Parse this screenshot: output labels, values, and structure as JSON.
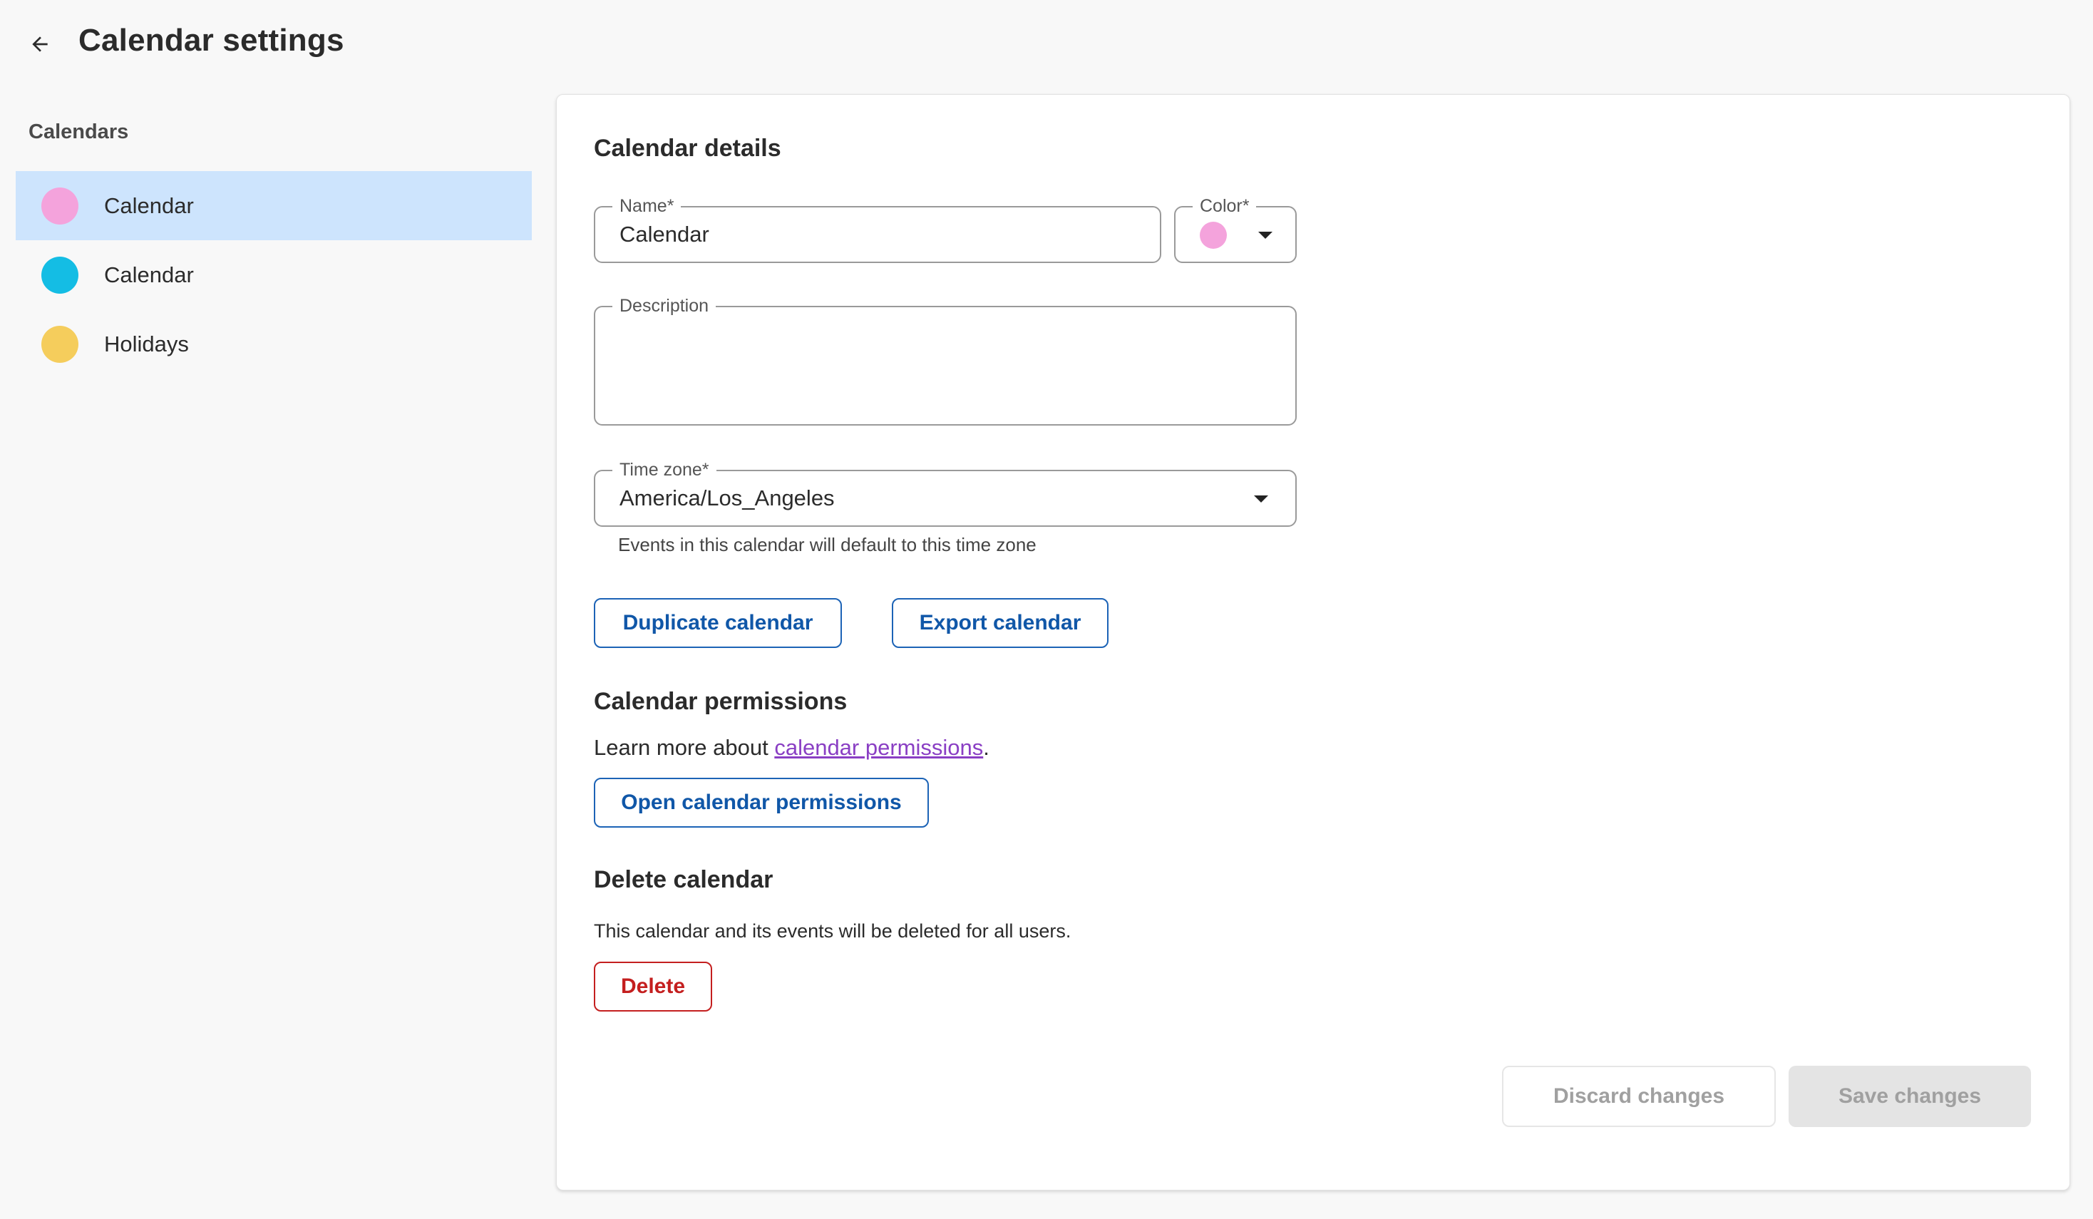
{
  "header": {
    "back_icon": "arrow-left-icon",
    "title": "Calendar settings"
  },
  "sidebar": {
    "heading": "Calendars",
    "items": [
      {
        "label": "Calendar",
        "color": "#f4a3dc",
        "selected": true
      },
      {
        "label": "Calendar",
        "color": "#14bde4",
        "selected": false
      },
      {
        "label": "Holidays",
        "color": "#f5cd5c",
        "selected": false
      }
    ]
  },
  "details": {
    "title": "Calendar details",
    "name": {
      "label": "Name",
      "required_mark": "*",
      "value": "Calendar"
    },
    "color": {
      "label": "Color",
      "required_mark": "*",
      "value": "#f4a3dc"
    },
    "description": {
      "label": "Description",
      "value": ""
    },
    "timezone": {
      "label": "Time zone",
      "required_mark": "*",
      "value": "America/Los_Angeles",
      "hint": "Events in this calendar will default to this time zone"
    },
    "duplicate_label": "Duplicate calendar",
    "export_label": "Export calendar"
  },
  "permissions": {
    "title": "Calendar permissions",
    "text_prefix": "Learn more about ",
    "link_text": "calendar permissions",
    "text_suffix": ".",
    "open_label": "Open calendar permissions"
  },
  "delete": {
    "title": "Delete calendar",
    "description": "This calendar and its events will be deleted for all users.",
    "button_label": "Delete"
  },
  "footer": {
    "discard_label": "Discard changes",
    "save_label": "Save changes"
  },
  "colors": {
    "accent": "#1c63b6",
    "danger": "#c41f1f",
    "selected_bg": "#cde4fd",
    "link": "#8a3fc4"
  }
}
